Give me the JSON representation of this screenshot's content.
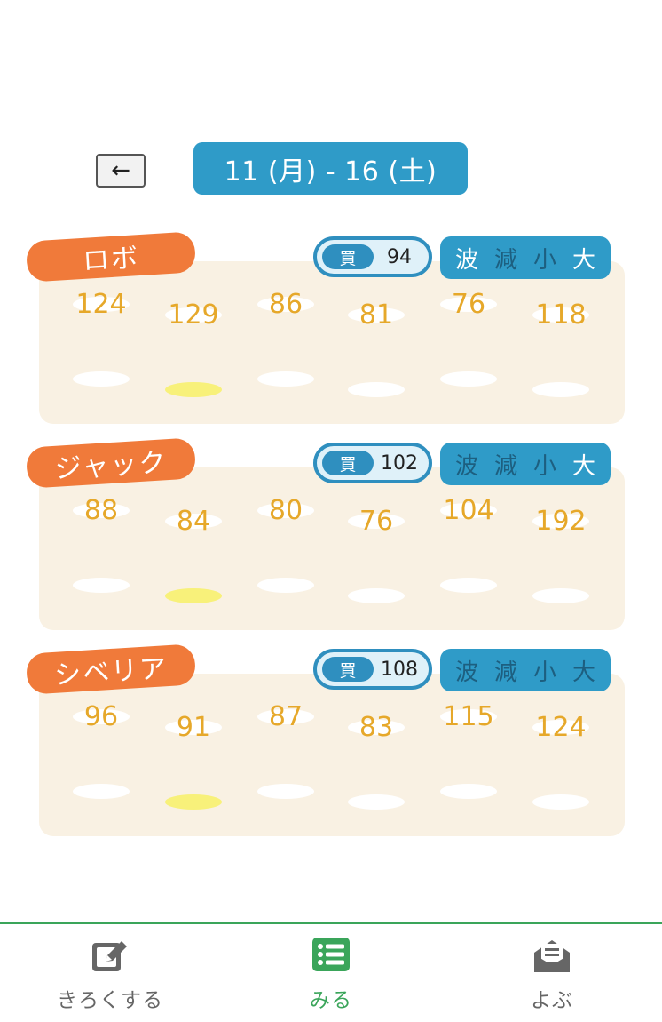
{
  "header": {
    "back_label": "←",
    "date_range": "11 (月) - 16 (土)"
  },
  "cards": [
    {
      "name": "ロボ",
      "buy_label": "買",
      "buy_price": "94",
      "patterns": [
        "波",
        "減",
        "小",
        "大"
      ],
      "prices": [
        "124",
        "129",
        "86",
        "81",
        "76",
        "118"
      ]
    },
    {
      "name": "ジャック",
      "buy_label": "買",
      "buy_price": "102",
      "patterns": [
        "波",
        "減",
        "小",
        "大"
      ],
      "prices": [
        "88",
        "84",
        "80",
        "76",
        "104",
        "192"
      ]
    },
    {
      "name": "シベリア",
      "buy_label": "買",
      "buy_price": "108",
      "patterns": [
        "波",
        "減",
        "小",
        "大"
      ],
      "prices": [
        "96",
        "91",
        "87",
        "83",
        "115",
        "124"
      ]
    }
  ],
  "nav": {
    "items": [
      {
        "label": "きろくする",
        "icon": "edit-icon"
      },
      {
        "label": "みる",
        "icon": "list-icon"
      },
      {
        "label": "よぶ",
        "icon": "mail-icon"
      }
    ],
    "active_index": 1
  },
  "colors": {
    "primary_blue": "#2f9bc8",
    "tag_orange": "#f07a3a",
    "price_yellow": "#e6a82a",
    "card_bg": "#f9f1e3",
    "nav_green": "#3aa55a",
    "highlight": "#f8f17a"
  }
}
